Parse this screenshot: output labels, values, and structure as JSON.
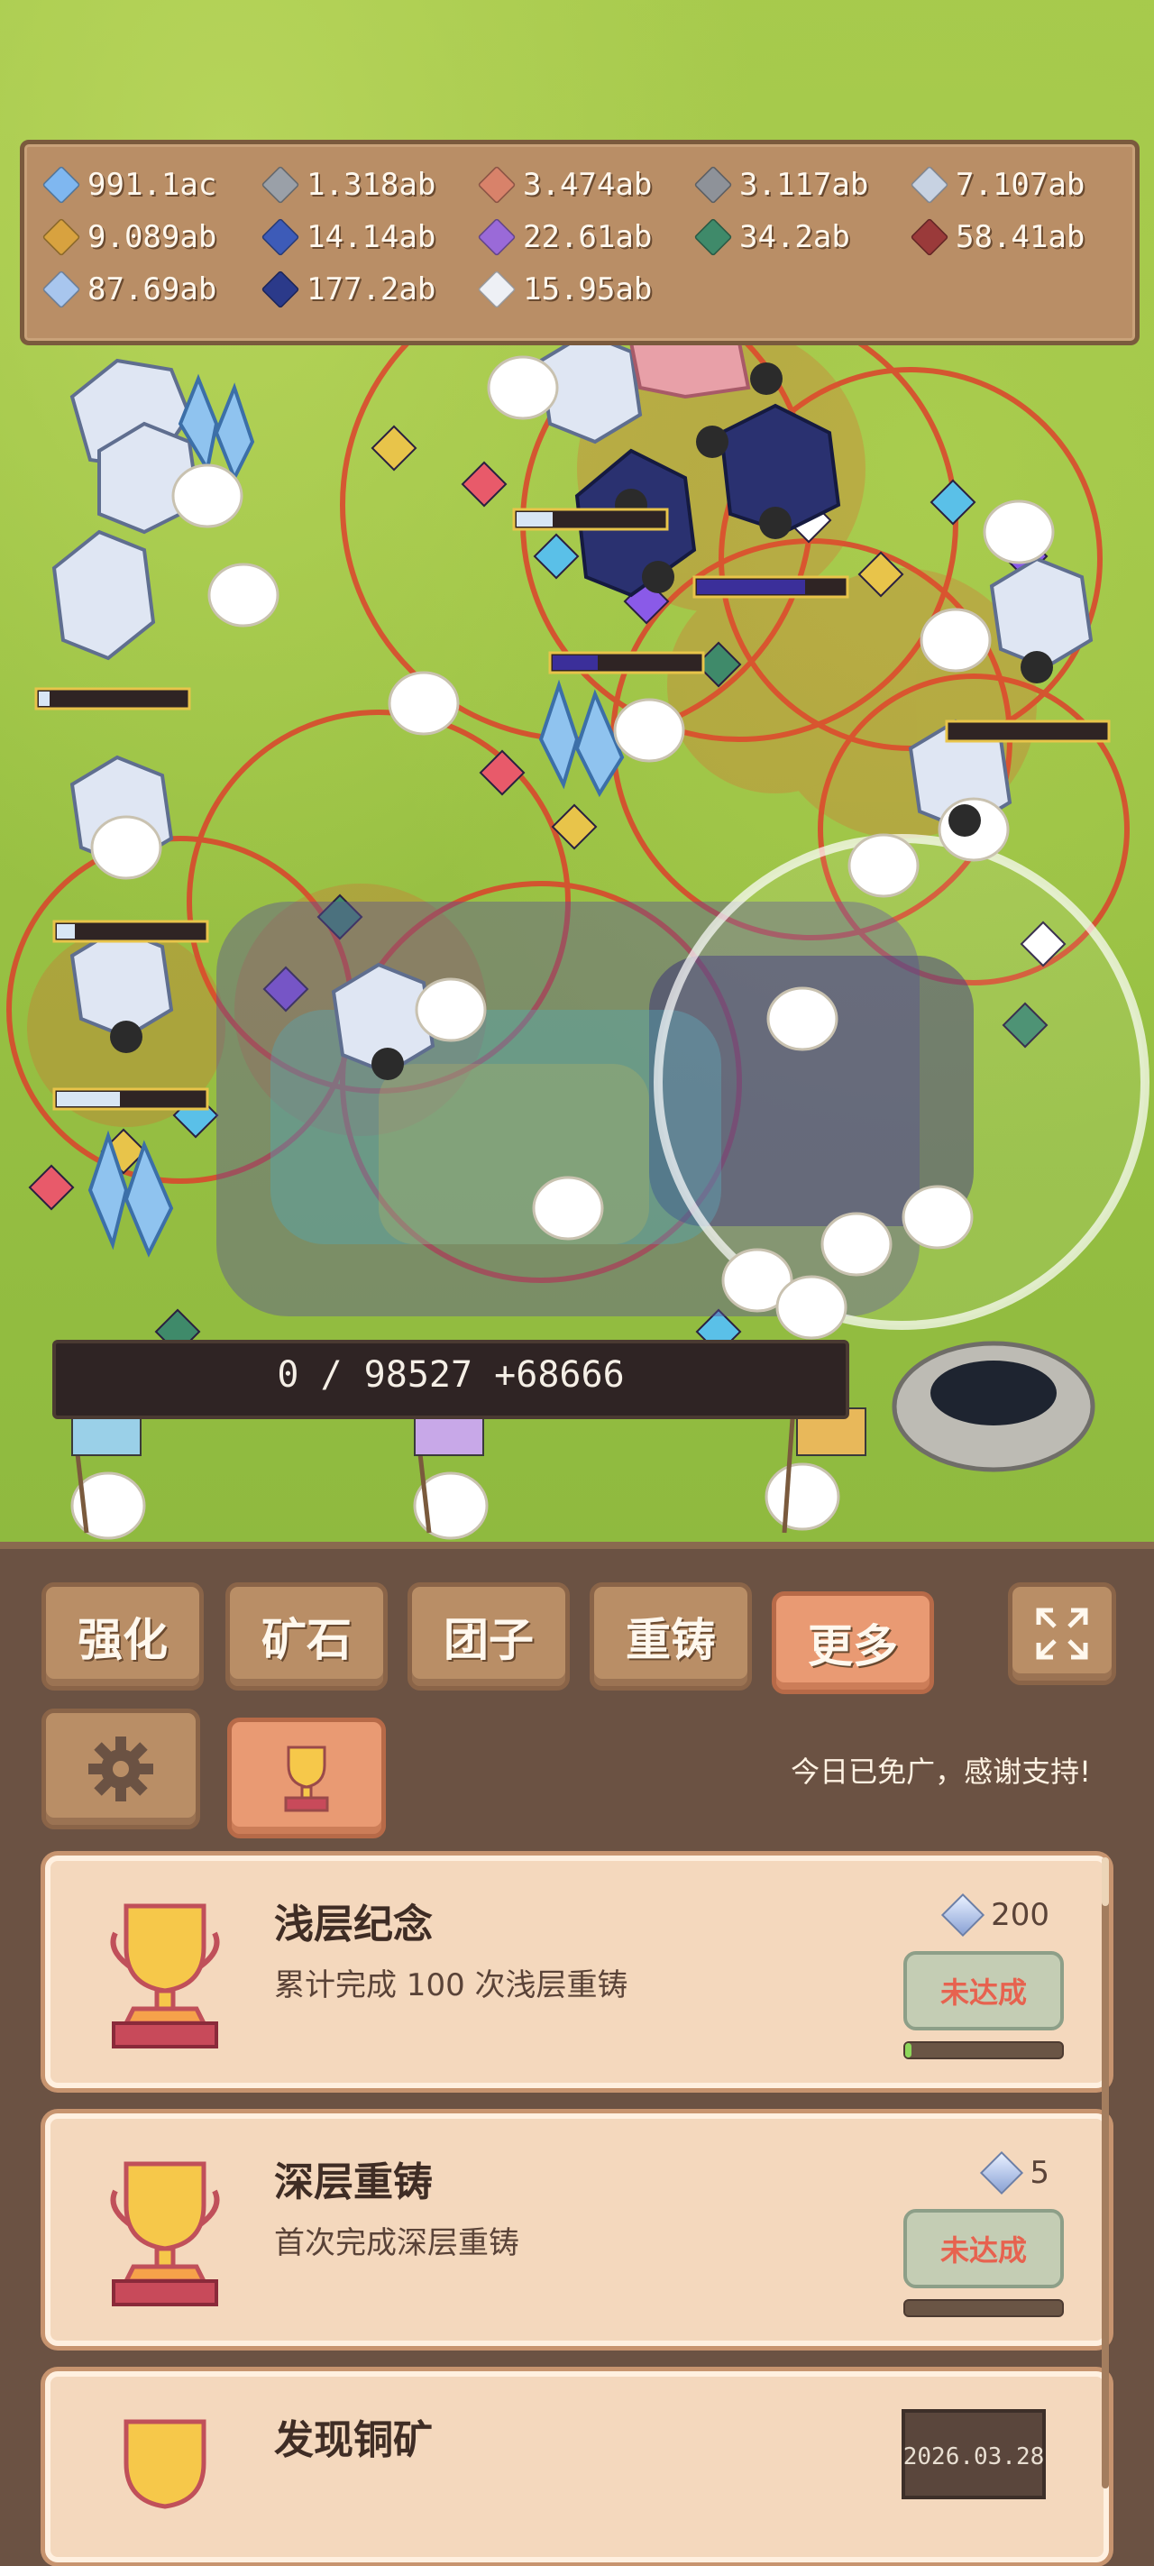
{
  "resources": [
    {
      "icon": "crystal-blue-icon",
      "value": "991.1ac",
      "color": "#7fb7f0"
    },
    {
      "icon": "ore-gray-icon",
      "value": "1.318ab",
      "color": "#9aa0a8"
    },
    {
      "icon": "ore-copper-icon",
      "value": "3.474ab",
      "color": "#d8826a"
    },
    {
      "icon": "ore-iron-icon",
      "value": "3.117ab",
      "color": "#8e9299"
    },
    {
      "icon": "ore-silver-icon",
      "value": "7.107ab",
      "color": "#c7d2e2"
    },
    {
      "icon": "ore-gold-icon",
      "value": "9.089ab",
      "color": "#d8a23f"
    },
    {
      "icon": "ore-sapphire-icon",
      "value": "14.14ab",
      "color": "#3d5bb8"
    },
    {
      "icon": "ore-amethyst-icon",
      "value": "22.61ab",
      "color": "#9a6ad8"
    },
    {
      "icon": "ore-jade-icon",
      "value": "34.2ab",
      "color": "#3f8a6a"
    },
    {
      "icon": "ore-ruby-icon",
      "value": "58.41ab",
      "color": "#9a3a3a"
    },
    {
      "icon": "ore-ice-icon",
      "value": "87.69ab",
      "color": "#a8c6ee"
    },
    {
      "icon": "ore-obsidian-icon",
      "value": "177.2ab",
      "color": "#2b3a8a"
    },
    {
      "icon": "ore-quartz-icon",
      "value": "15.95ab",
      "color": "#eef0f5"
    }
  ],
  "progress_text": "0 / 98527  +68666",
  "tabs": [
    {
      "label": "强化",
      "active": false
    },
    {
      "label": "矿石",
      "active": false
    },
    {
      "label": "团子",
      "active": false
    },
    {
      "label": "重铸",
      "active": false
    },
    {
      "label": "更多",
      "active": true
    }
  ],
  "ad_note": "今日已免广，感谢支持!",
  "achievements": [
    {
      "title": "浅层纪念",
      "desc": "累计完成 100 次浅层重铸",
      "reward": "200",
      "status": "未达成",
      "progress": 0.02
    },
    {
      "title": "深层重铸",
      "desc": "首次完成深层重铸",
      "reward": "5",
      "status": "未达成",
      "progress": 0
    },
    {
      "title": "发现铜矿",
      "desc": "",
      "reward": "",
      "status": "",
      "progress": 0,
      "date": "2026.03.28"
    }
  ]
}
